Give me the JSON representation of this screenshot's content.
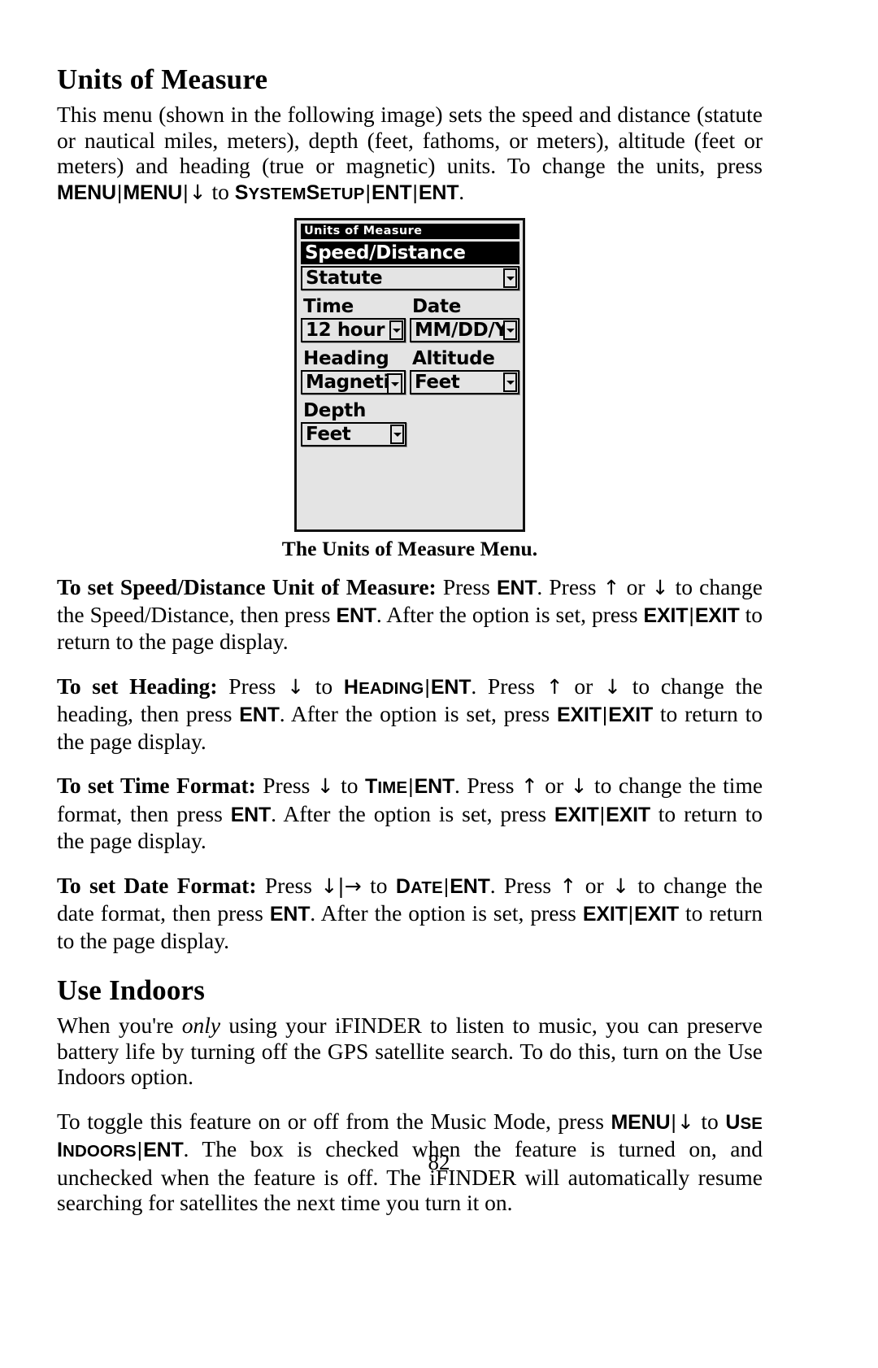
{
  "page": {
    "number": "82"
  },
  "sections": [
    {
      "id": "units-of-measure",
      "heading": "Units of Measure"
    },
    {
      "id": "use-indoors",
      "heading": "Use Indoors"
    }
  ],
  "intro": {
    "part1": "This menu (shown in the following image) sets the speed and distance (statute or nautical miles, meters), depth (feet, fathoms, or meters), altitude (feet or meters) and heading (true or magnetic) units. To change the units, press ",
    "key_menu_1": "MENU",
    "sep1": "|",
    "key_menu_2": "MENU",
    "sep2": "|",
    "arrow_down": "↓",
    "mid": " to ",
    "menu_system_setup_big1": "S",
    "menu_system_setup_rest1": "YSTEM",
    "menu_system_setup_big2": "S",
    "menu_system_setup_rest2": "ETUP",
    "sep3": "|",
    "key_ent_1": "ENT",
    "sep4": "|",
    "key_ent_2": "ENT",
    "period": "."
  },
  "device": {
    "title": "Units of Measure",
    "highlight_row": "Speed/Distance",
    "speed_distance": {
      "value": "Statute"
    },
    "time": {
      "label": "Time",
      "value": "12 hour"
    },
    "date": {
      "label": "Date",
      "value": "MM/DD/Y"
    },
    "heading": {
      "label": "Heading",
      "value": "Magnetic"
    },
    "altitude": {
      "label": "Altitude",
      "value": "Feet"
    },
    "depth": {
      "label": "Depth",
      "value": "Feet"
    }
  },
  "figure_caption": "The Units of Measure Menu.",
  "instructions": {
    "speed_distance": {
      "lead": "To set Speed/Distance Unit of Measure:",
      "t1": " Press ",
      "k1": "ENT",
      "t2": ". Press ",
      "a1": "↑",
      "t3": " or ",
      "a2": "↓",
      "t4": " to change the Speed/Distance, then press ",
      "k2": "ENT",
      "t5": ". After the option is set, press ",
      "k3": "EXIT",
      "s1": "|",
      "k4": "EXIT",
      "t6": " to return to the page display."
    },
    "heading": {
      "lead": "To set Heading:",
      "t1": " Press ",
      "a1": "↓",
      "t2": " to ",
      "m_big": "H",
      "m_rest": "EADING",
      "s1": "|",
      "k1": "ENT",
      "t3": ". Press ",
      "a2": "↑",
      "t4": " or ",
      "a3": "↓",
      "t5": " to change the heading, then press ",
      "k2": "ENT",
      "t6": ". After the option is set, press ",
      "k3": "EXIT",
      "s2": "|",
      "k4": "EXIT",
      "t7": " to return to the page display."
    },
    "time_format": {
      "lead": "To set Time Format:",
      "t1": " Press ",
      "a1": "↓",
      "t2": " to ",
      "m_big": "T",
      "m_rest": "IME",
      "s1": "|",
      "k1": "ENT",
      "t3": ". Press ",
      "a2": "↑",
      "t4": " or ",
      "a3": "↓",
      "t5": " to change the time format, then press ",
      "k2": "ENT",
      "t6": ". After the option is set, press ",
      "k3": "EXIT",
      "s2": "|",
      "k4": "EXIT",
      "t7": " to return to the page display."
    },
    "date_format": {
      "lead": "To set Date Format:",
      "t1": " Press ",
      "a1": "↓",
      "bar": "|",
      "a2": "→",
      "t2": " to ",
      "m_big": "D",
      "m_rest": "ATE",
      "s1": "|",
      "k1": "ENT",
      "t3": ". Press ",
      "a3": "↑",
      "t4": " or ",
      "a4": "↓",
      "t5": " to change the date format, then press ",
      "k2": "ENT",
      "t6": ". After the option is set, press ",
      "k3": "EXIT",
      "s2": "|",
      "k4": "EXIT",
      "t7": " to return to the page display."
    }
  },
  "use_indoors": {
    "para1_a": "When you're ",
    "para1_italic": "only",
    "para1_b": " using your iFINDER to listen to music, you can preserve battery life by turning off the GPS satellite search. To do this, turn on the Use Indoors option.",
    "para2_a": "To toggle this feature on or off from the Music Mode, press ",
    "k_menu": "MENU",
    "s1": "|",
    "a_down": "↓",
    "para2_b": " to ",
    "m_big1": "U",
    "m_rest1": "SE ",
    "m_big2": "I",
    "m_rest2": "NDOORS",
    "s2": "|",
    "k_ent": "ENT",
    "para2_c": ". The box is checked when the feature is turned on, and unchecked when the feature is off. The iFINDER will automatically resume searching for satellites the next time you turn it on."
  }
}
